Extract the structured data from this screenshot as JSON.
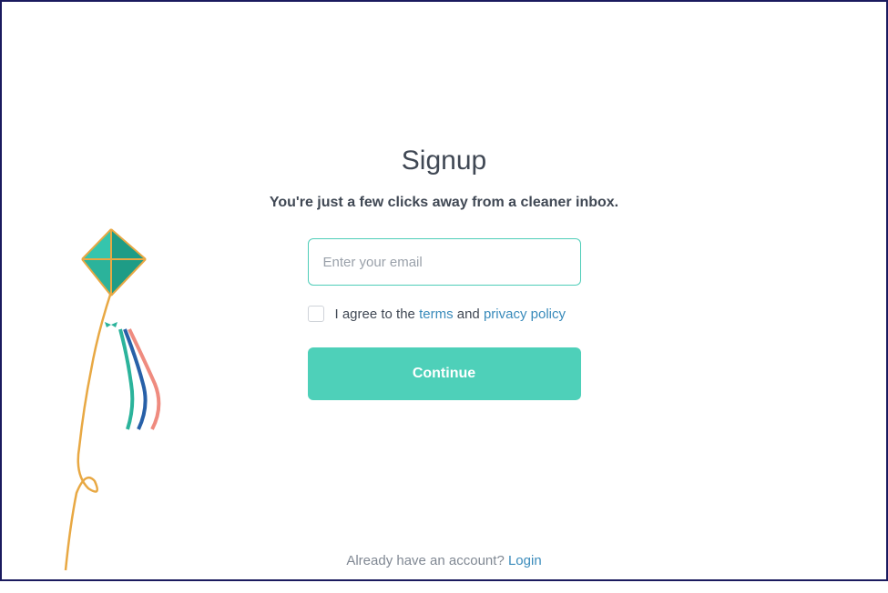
{
  "signup": {
    "title": "Signup",
    "subtitle": "You're just a few clicks away from a cleaner inbox.",
    "email_placeholder": "Enter your email",
    "consent": {
      "prefix": "I agree to the ",
      "terms_label": "terms",
      "middle": " and ",
      "privacy_label": "privacy policy"
    },
    "continue_label": "Continue"
  },
  "footer": {
    "prompt": "Already have an account? ",
    "login_label": "Login"
  }
}
